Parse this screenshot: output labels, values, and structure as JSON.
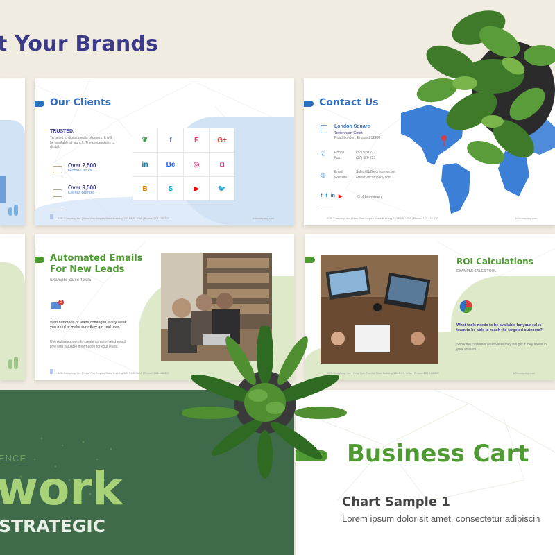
{
  "heading": "t Your Brands",
  "slide_clients": {
    "title": "Our Clients",
    "trusted_label": "TRUSTED.",
    "trusted_text": "Targeted to digital media planners. It will be available at launch. The credential is to digital.",
    "stat1_value": "Over 2,500",
    "stat1_label": "Global Clients.",
    "stat2_value": "Over 9,500",
    "stat2_label": "Client's Brands.",
    "footer": "B2B Company, Inc. | New York Empire State Building 120 RHS, USA | Phone: 123 456 222",
    "footer_right": "b2bcompany.com",
    "logos": [
      "leaf-logo",
      "facebook-logo",
      "foursquare-logo",
      "googleplus-logo",
      "linkedin-logo",
      "behance-logo",
      "dribbble-logo",
      "instagram-logo",
      "blogger-logo",
      "skype-logo",
      "youtube-logo",
      "twitter-logo"
    ],
    "logo_colors": [
      "#3a9a4a",
      "#3b5998",
      "#f94877",
      "#dd4b39",
      "#0077b5",
      "#1769ff",
      "#ea4c89",
      "#c13584",
      "#f57d00",
      "#00aff0",
      "#ff0000",
      "#1da1f2"
    ],
    "logo_glyphs": [
      "❦",
      "f",
      "F",
      "G+",
      "in",
      "Bē",
      "◎",
      "◘",
      "B",
      "S",
      "▶",
      "🐦"
    ]
  },
  "slide_contact": {
    "title": "Contact Us",
    "addr_title": "London Square",
    "addr_line1": "Tottenham Court",
    "addr_line2": "Road London, England 12993",
    "phone_label": "Phone",
    "phone_value": "(37) 920 222",
    "fax_label": "Fax",
    "fax_value": "(37) 920 221",
    "email_label": "Email",
    "email_value": "Sales@b2bcompany.com",
    "website_label": "Website",
    "website_value": "www.b2bcompany.com",
    "handle": "@b2bcompany",
    "footer": "B2B Company, Inc. | New York Empire State Building 120 RHS, USA | Phone: 123 456 222",
    "footer_right": "b2bcompany.com"
  },
  "slide_emails": {
    "title_line1": "Automated Emails",
    "title_line2": "For New Leads",
    "subtitle": "Example Sales Tools",
    "body1": "With hundreds of leads coming in every week you need to make sure they get real love.",
    "body2": "Use Autoresponers to create an automated email flow with valuable information for your leads.",
    "badge": "2",
    "footer": "B2B Company, Inc. | New York Empire State Building 120 RHS, USA | Phone: 123 456 222"
  },
  "slide_roi": {
    "title": "ROI Calculations",
    "subtitle": "EXAMPLE SALES TOOL",
    "question": "What tools needs to be available for your sales team to be able to reach the targeted outcome?",
    "body": "Show the customer what value they will get if they invest in your solution.",
    "footer": "B2B Company, Inc. | New York Empire State Building 120 RHS, USA | Phone: 123 456 222",
    "footer_right": "b2bcompany.com"
  },
  "slide_dark": {
    "small": "ENCE",
    "big": "work",
    "sub": "STRATEGIC"
  },
  "slide_cart": {
    "title": "Business Cart",
    "chart_title": "Chart Sample 1",
    "lorem": "Lorem ipsum dolor sit amet, consectetur adipiscin"
  },
  "colors": {
    "navy": "#3b3a87",
    "blue": "#2f6fc1",
    "green": "#4f9a32",
    "dark_green": "#3f6b4b",
    "light_blue": "#d3e3f6",
    "light_green": "#dde9c9"
  }
}
